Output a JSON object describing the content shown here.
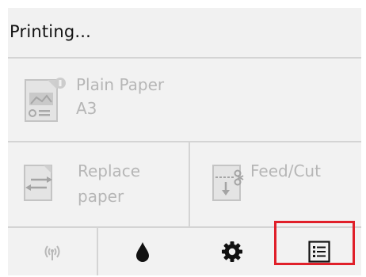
{
  "status": {
    "title": "Printing..."
  },
  "paper": {
    "icon": "paper-info-icon",
    "type": "Plain Paper",
    "size": "A3"
  },
  "actions": [
    {
      "icon": "replace-paper-icon",
      "line1": "Replace",
      "line2": "paper"
    },
    {
      "icon": "feed-cut-icon",
      "label": "Feed/Cut"
    }
  ],
  "tabs": [
    {
      "icon": "wireless-icon"
    },
    {
      "icon": "ink-drop-icon"
    },
    {
      "icon": "gear-icon"
    },
    {
      "icon": "list-menu-icon",
      "selected": true
    }
  ],
  "colors": {
    "highlight": "#e0202a",
    "disabled_text": "#b6b6b6",
    "background": "#f2f2f2"
  }
}
